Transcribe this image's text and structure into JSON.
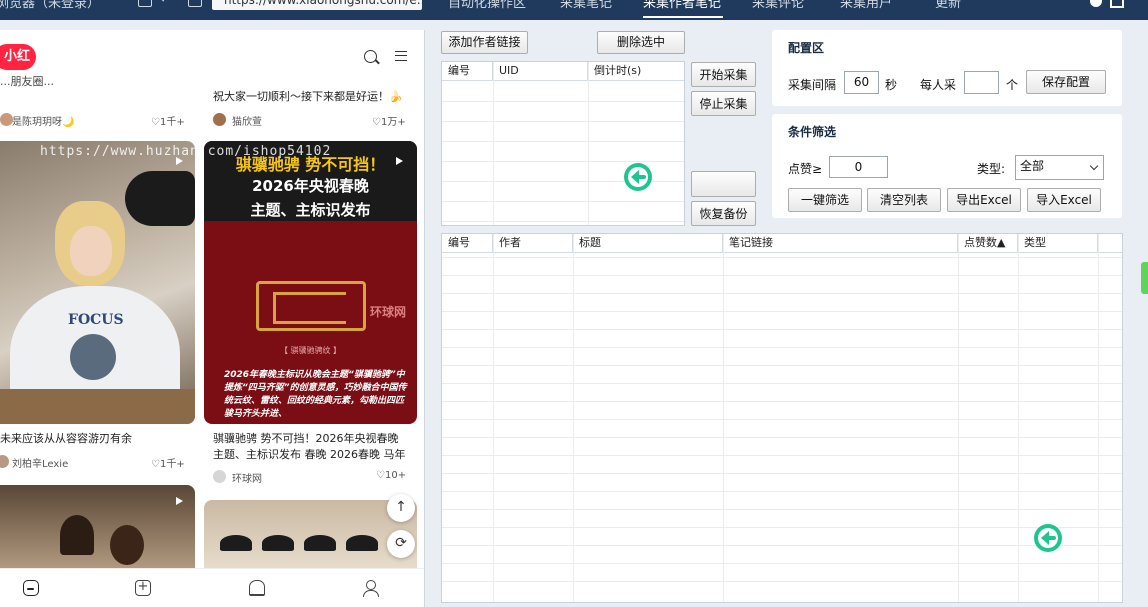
{
  "topbar": {
    "app_title": "浏览器（未登录）",
    "url": "https://www.xiaohongshu.com/e...",
    "tabs": [
      "自动化操作区",
      "采集笔记",
      "采集作者笔记",
      "采集评论",
      "采集用户",
      "更新"
    ],
    "active_tab_index": 2
  },
  "browser": {
    "logo": "小红书",
    "watermark": "https://www.huzhan.com/ishop54102",
    "cards": [
      {
        "title": "...朋友圈...",
        "author": "是陈玥玥呀🌙",
        "likes": "1千+"
      },
      {
        "title": "祝大家一切顺利～接下来都是好运！🍌",
        "author": "猫欣萱",
        "likes": "1万+"
      },
      {
        "title": "未来应该从从容容游刃有余",
        "author": "刘柏辛Lexie",
        "likes": "1千+"
      },
      {
        "title": "骐骥驰骋 势不可挡！2026年央视春晚主题、主标识发布 春晚 2026春晚 马年",
        "author": "环球网",
        "likes": "10+"
      }
    ],
    "poster": {
      "line1": "骐骥驰骋 势不可挡！",
      "line2": "2026年央视春晚",
      "line3": "主题、主标识发布",
      "source": "环球网",
      "caption": "【 骐骥驰骋纹 】",
      "desc": "2026年春晚主标识从晚会主题“骐骥驰骋”中提炼“四马齐驱”的创意灵感，巧妙融合中国传统云纹、雷纹、回纹的经典元素，勾勒出四匹骏马齐头并进、"
    },
    "fab_up": "↑",
    "fab_refresh": "⟳",
    "tabbar_plus": "+"
  },
  "author_panel": {
    "add_button": "添加作者链接",
    "delete_button": "删除选中",
    "start_button": "开始采集",
    "stop_button": "停止采集",
    "blank_button": "",
    "restore_button": "恢复备份",
    "columns": [
      "编号",
      "UID",
      "倒计时(s)"
    ]
  },
  "config": {
    "title": "配置区",
    "interval_label": "采集间隔",
    "interval_value": "60",
    "interval_unit": "秒",
    "per_person_label": "每人采",
    "per_person_value": "",
    "per_person_unit": "个",
    "save_button": "保存配置"
  },
  "filter": {
    "title": "条件筛选",
    "likes_label": "点赞≥",
    "likes_value": "0",
    "type_label": "类型:",
    "type_value": "全部",
    "filter_button": "一键筛选",
    "clear_button": "清空列表",
    "export_button": "导出Excel",
    "import_button": "导入Excel"
  },
  "results": {
    "columns": [
      "编号",
      "作者",
      "标题",
      "笔记链接",
      "点赞数▲",
      "类型"
    ]
  },
  "colors": {
    "brand": "#ff2442",
    "accent": "#1ec58e",
    "topbar": "#1f3a5c"
  }
}
